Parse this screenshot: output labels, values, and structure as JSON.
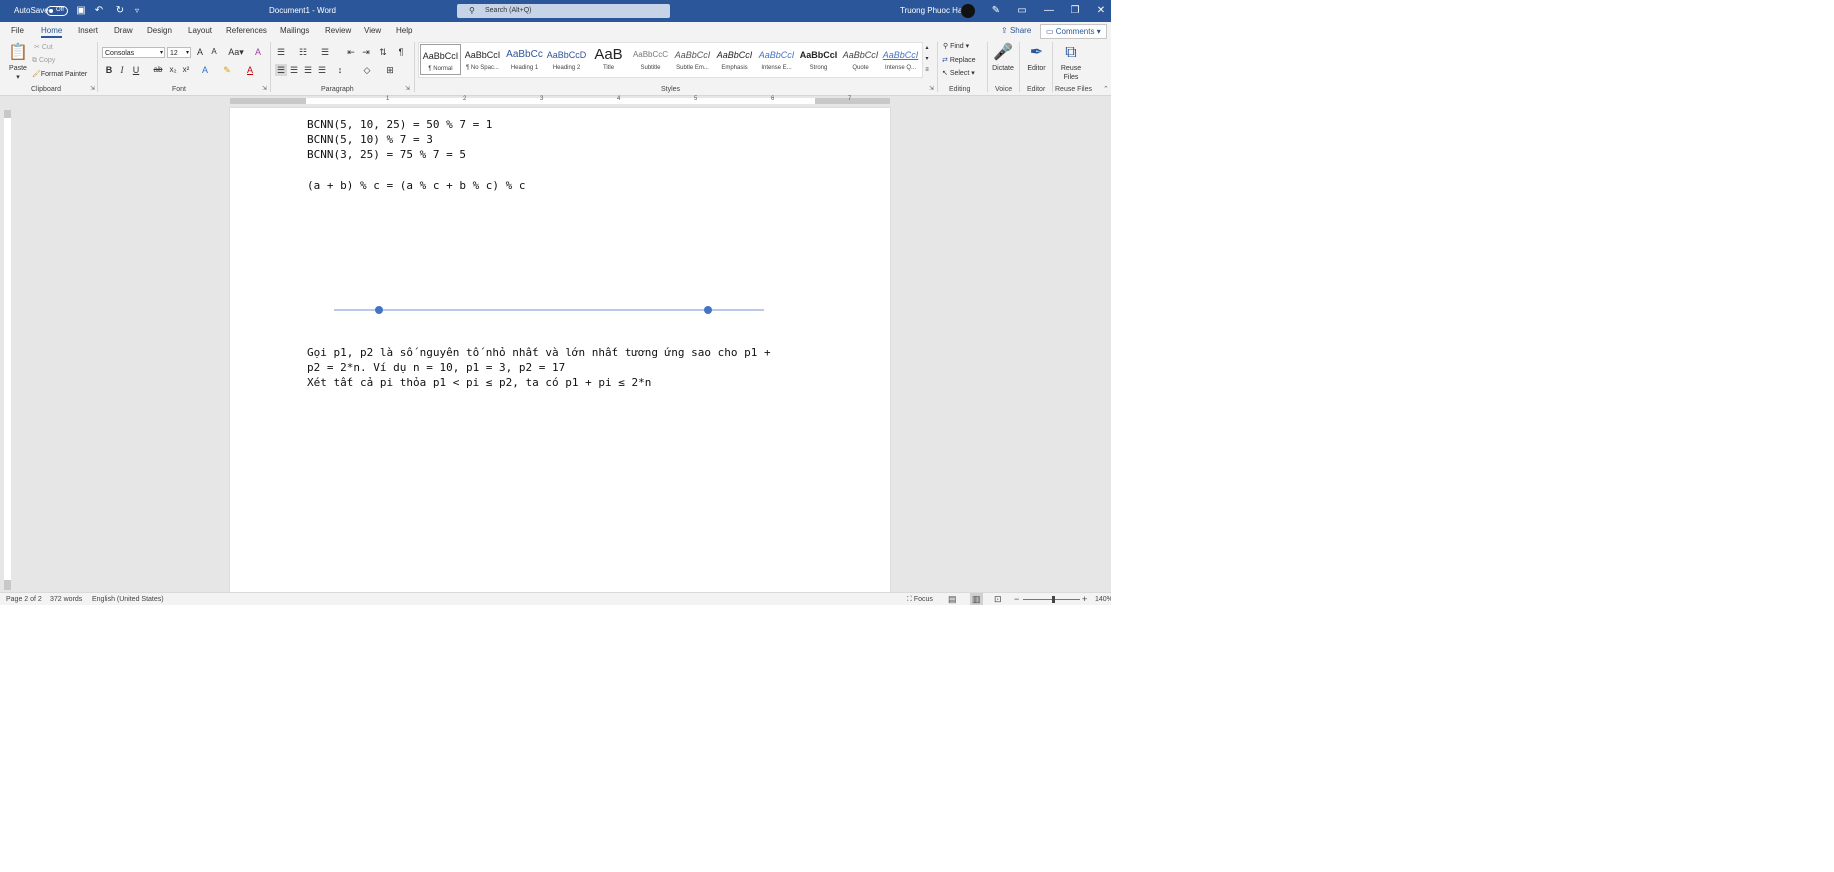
{
  "titlebar": {
    "autosave_label": "AutoSave",
    "autosave_state": "Off",
    "doc_title": "Document1",
    "app_name": "Word",
    "title_separator": " - ",
    "search_placeholder": "Search (Alt+Q)",
    "user_name": "Truong Phuoc Hai"
  },
  "tabs": [
    "File",
    "Home",
    "Insert",
    "Draw",
    "Design",
    "Layout",
    "References",
    "Mailings",
    "Review",
    "View",
    "Help"
  ],
  "active_tab": "Home",
  "header_buttons": {
    "share": "Share",
    "comments": "Comments"
  },
  "ribbon": {
    "clipboard": {
      "paste": "Paste",
      "cut": "Cut",
      "copy": "Copy",
      "format_painter": "Format Painter",
      "label": "Clipboard"
    },
    "font": {
      "family": "Consolas",
      "size": "12",
      "label": "Font",
      "buttons": {
        "bold": "B",
        "italic": "I",
        "underline": "U",
        "strike": "ab",
        "sub": "x₂",
        "sup": "x²"
      }
    },
    "paragraph": {
      "label": "Paragraph"
    },
    "styles": {
      "label": "Styles",
      "items": [
        {
          "preview": "AaBbCcI",
          "name": "¶ Normal"
        },
        {
          "preview": "AaBbCcI",
          "name": "¶ No Spac..."
        },
        {
          "preview": "AaBbCc",
          "name": "Heading 1"
        },
        {
          "preview": "AaBbCcD",
          "name": "Heading 2"
        },
        {
          "preview": "AaB",
          "name": "Title"
        },
        {
          "preview": "AaBbCcC",
          "name": "Subtitle"
        },
        {
          "preview": "AaBbCcI",
          "name": "Subtle Em..."
        },
        {
          "preview": "AaBbCcI",
          "name": "Emphasis"
        },
        {
          "preview": "AaBbCcI",
          "name": "Intense E..."
        },
        {
          "preview": "AaBbCcI",
          "name": "Strong"
        },
        {
          "preview": "AaBbCcI",
          "name": "Quote"
        },
        {
          "preview": "AaBbCcI",
          "name": "Intense Q..."
        }
      ]
    },
    "editing": {
      "find": "Find",
      "replace": "Replace",
      "select": "Select",
      "label": "Editing"
    },
    "voice": {
      "dictate": "Dictate",
      "label": "Voice"
    },
    "editor": {
      "editor": "Editor",
      "label": "Editor"
    },
    "reuse": {
      "reuse_line1": "Reuse",
      "reuse_line2": "Files",
      "label": "Reuse Files"
    }
  },
  "ruler_numbers": [
    "1",
    "2",
    "3",
    "4",
    "5",
    "6",
    "7"
  ],
  "document": {
    "lines": [
      "BCNN(5, 10, 25) = 50 % 7 = 1",
      "BCNN(5, 10) % 7 = 3",
      "BCNN(3, 25) = 75 % 7 = 5",
      "(a + b) % c = (a % c + b % c) % c",
      "Gọi p1, p2 là số nguyên tố nhỏ nhất và lớn nhất tương ứng sao cho p1 +",
      "p2 = 2*n. Ví dụ n = 10, p1 = 3, p2 = 17",
      "Xét tất cả pi thỏa p1 < pi ≤ p2, ta có p1 + pi ≤ 2*n"
    ]
  },
  "statusbar": {
    "page": "Page 2 of 2",
    "words": "372 words",
    "language": "English (United States)",
    "focus": "Focus",
    "zoom": "140%"
  },
  "colors": {
    "brand": "#2b579a",
    "connector": "#4472c4"
  },
  "icons": [
    "save-icon",
    "undo-icon",
    "redo-icon",
    "customize-icon",
    "search-icon",
    "pen-icon",
    "ribbon-display-icon",
    "minimize-icon",
    "restore-icon",
    "close-icon",
    "share-icon",
    "comment-icon",
    "paste-icon",
    "cut-icon",
    "copy-icon",
    "format-painter-icon",
    "find-icon",
    "replace-icon",
    "select-icon",
    "microphone-icon",
    "editor-icon",
    "reuse-files-icon",
    "focus-icon",
    "read-mode-icon",
    "print-layout-icon",
    "web-layout-icon"
  ]
}
